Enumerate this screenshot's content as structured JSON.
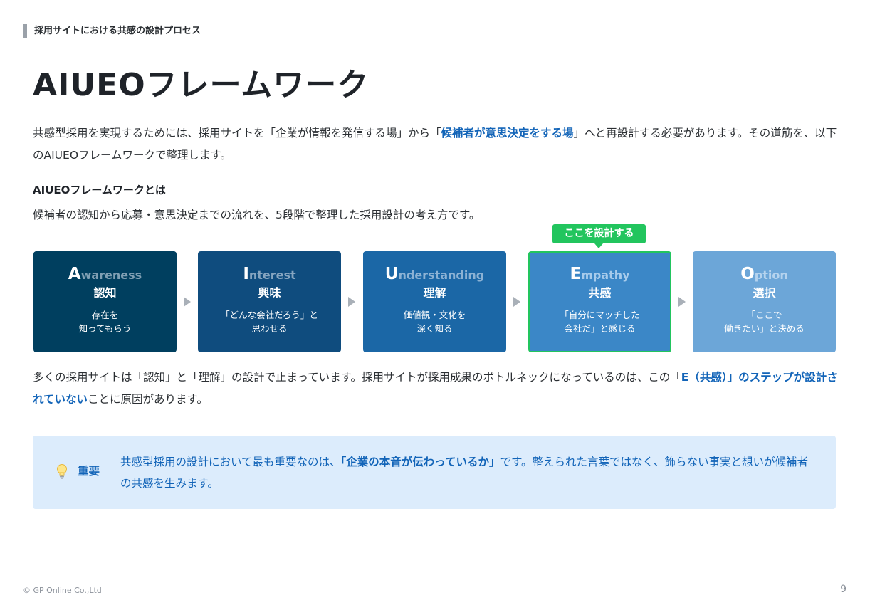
{
  "header": {
    "section": "採用サイトにおける共感の設計プロセス"
  },
  "title": "AIUEOフレームワーク",
  "intro": {
    "part1": "共感型採用を実現するためには、採用サイトを「企業が情報を発信する場」から「",
    "highlight": "候補者が意思決定をする場",
    "part2": "」へと再設計する必要があります。その道筋を、以下のAIUEOフレームワークで整理します。"
  },
  "definition": {
    "heading": "AIUEOフレームワークとは",
    "text": "候補者の認知から応募・意思決定までの流れを、5段階で整理した採用設計の考え方です。"
  },
  "callout": "ここを設計する",
  "steps": [
    {
      "initial": "A",
      "rest": "wareness",
      "jp": "認知",
      "sub": "存在を\n知ってもらう",
      "color": "#003f5f"
    },
    {
      "initial": "I",
      "rest": "nterest",
      "jp": "興味",
      "sub": "「どんな会社だろう」と\n思わせる",
      "color": "#0f4c7e"
    },
    {
      "initial": "U",
      "rest": "nderstanding",
      "jp": "理解",
      "sub": "価値観・文化を\n深く知る",
      "color": "#1b67a6"
    },
    {
      "initial": "E",
      "rest": "mpathy",
      "jp": "共感",
      "sub": "「自分にマッチした\n会社だ」と感じる",
      "color": "#3b87c7"
    },
    {
      "initial": "O",
      "rest": "ption",
      "jp": "選択",
      "sub": "「ここで\n働きたい」と決める",
      "color": "#6ca6d8"
    }
  ],
  "summary": {
    "part1": "多くの採用サイトは「認知」と「理解」の設計で止まっています。採用サイトが採用成果のボトルネックになっているのは、この「",
    "highlight": "E（共感）」のステップが設計されていない",
    "part2": "ことに原因があります。"
  },
  "important": {
    "label": "重要",
    "part1": "共感型採用の設計において最も重要なのは、",
    "highlight": "「企業の本音が伝わっているか」",
    "part2": "です。整えられた言葉ではなく、飾らない事実と想いが候補者の共感を生みます。"
  },
  "footer": {
    "copyright": "© GP Online Co.,Ltd",
    "page": "9"
  },
  "colors": {
    "accent": "#1264b8",
    "highlight_green": "#22c55e",
    "callout_bg": "#dcecfc"
  },
  "icons": {
    "important": "lightbulb-icon",
    "step_separator": "triangle-right-icon"
  }
}
